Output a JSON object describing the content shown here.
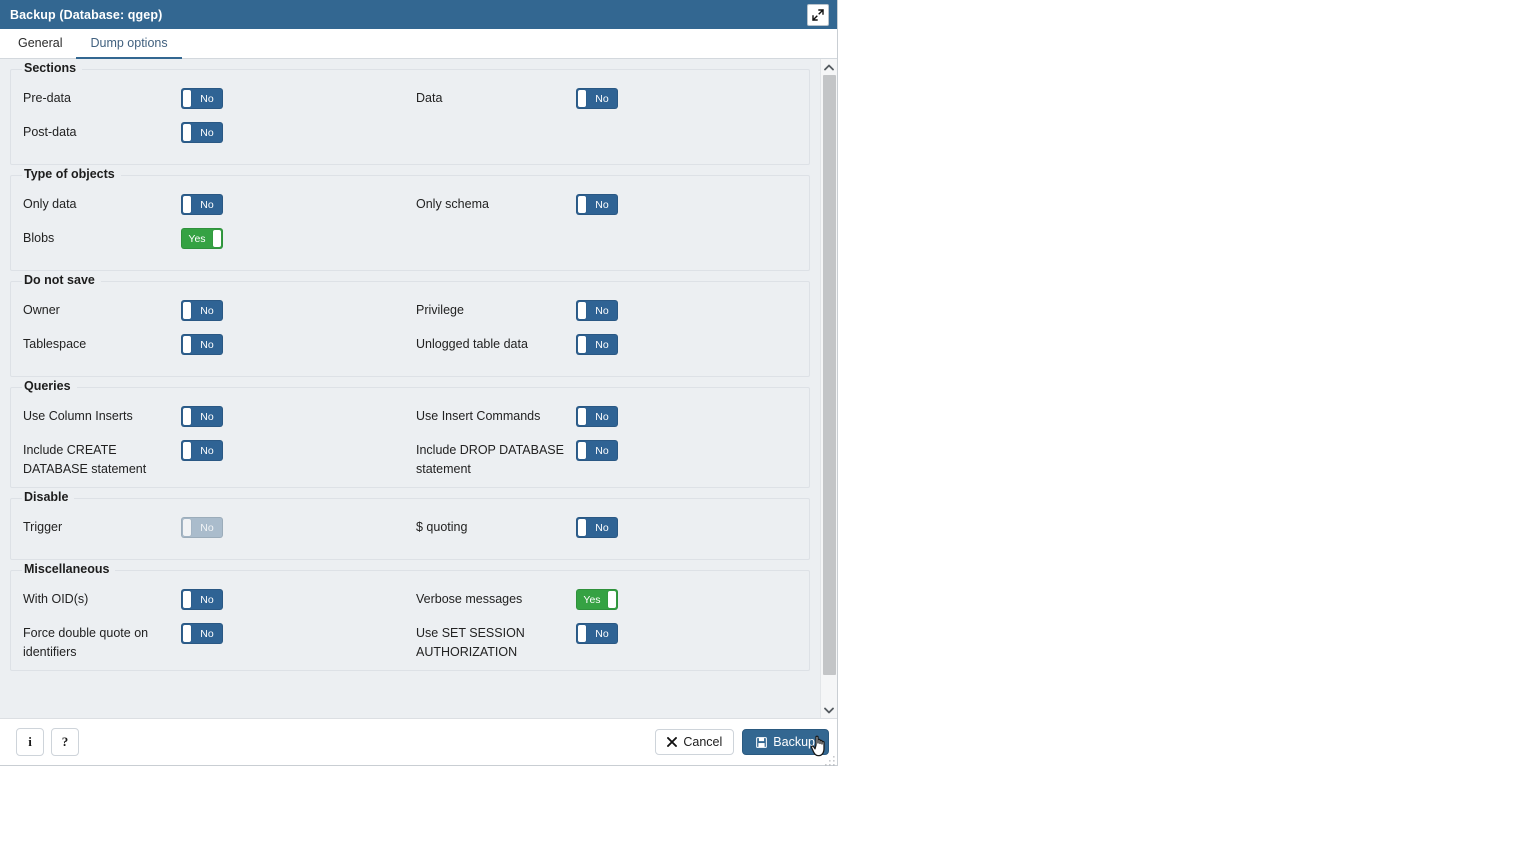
{
  "window": {
    "title": "Backup (Database: qgep)",
    "maximize_icon": "expand-diagonal-icon"
  },
  "tabs": [
    {
      "label": "General",
      "active": false
    },
    {
      "label": "Dump options",
      "active": true
    }
  ],
  "sections": [
    {
      "title": "Sections",
      "rows": [
        [
          {
            "label": "Pre-data",
            "value": "No",
            "state": "off",
            "disabled": false
          },
          {
            "label": "Data",
            "value": "No",
            "state": "off",
            "disabled": false
          }
        ],
        [
          {
            "label": "Post-data",
            "value": "No",
            "state": "off",
            "disabled": false
          },
          null
        ]
      ]
    },
    {
      "title": "Type of objects",
      "rows": [
        [
          {
            "label": "Only data",
            "value": "No",
            "state": "off",
            "disabled": false
          },
          {
            "label": "Only schema",
            "value": "No",
            "state": "off",
            "disabled": false
          }
        ],
        [
          {
            "label": "Blobs",
            "value": "Yes",
            "state": "on",
            "disabled": false
          },
          null
        ]
      ]
    },
    {
      "title": "Do not save",
      "rows": [
        [
          {
            "label": "Owner",
            "value": "No",
            "state": "off",
            "disabled": false
          },
          {
            "label": "Privilege",
            "value": "No",
            "state": "off",
            "disabled": false
          }
        ],
        [
          {
            "label": "Tablespace",
            "value": "No",
            "state": "off",
            "disabled": false
          },
          {
            "label": "Unlogged table data",
            "value": "No",
            "state": "off",
            "disabled": false
          }
        ]
      ]
    },
    {
      "title": "Queries",
      "rows": [
        [
          {
            "label": "Use Column Inserts",
            "value": "No",
            "state": "off",
            "disabled": false
          },
          {
            "label": "Use Insert Commands",
            "value": "No",
            "state": "off",
            "disabled": false
          }
        ],
        [
          {
            "label": "Include CREATE DATABASE statement",
            "value": "No",
            "state": "off",
            "disabled": false
          },
          {
            "label": "Include DROP DATABASE statement",
            "value": "No",
            "state": "off",
            "disabled": false
          }
        ]
      ]
    },
    {
      "title": "Disable",
      "rows": [
        [
          {
            "label": "Trigger",
            "value": "No",
            "state": "off",
            "disabled": true
          },
          {
            "label": "$ quoting",
            "value": "No",
            "state": "off",
            "disabled": false
          }
        ]
      ]
    },
    {
      "title": "Miscellaneous",
      "rows": [
        [
          {
            "label": "With OID(s)",
            "value": "No",
            "state": "off",
            "disabled": false
          },
          {
            "label": "Verbose messages",
            "value": "Yes",
            "state": "on",
            "disabled": false
          }
        ],
        [
          {
            "label": "Force double quote on identifiers",
            "value": "No",
            "state": "off",
            "disabled": false
          },
          {
            "label": "Use SET SESSION AUTHORIZATION",
            "value": "No",
            "state": "off",
            "disabled": false
          }
        ]
      ]
    }
  ],
  "scrollbar": {
    "up_icon": "chevron-up-icon",
    "down_icon": "chevron-down-icon"
  },
  "footer": {
    "info_label": "i",
    "help_label": "?",
    "cancel_label": "Cancel",
    "cancel_icon": "cross-icon",
    "backup_label": "Backup",
    "backup_icon": "floppy-save-icon"
  },
  "colors": {
    "titlebar": "#336791",
    "accent": "#336791",
    "toggle_off": "#2f6394",
    "toggle_on": "#35a243",
    "toggle_disabled": "#9fb4c6",
    "body_bg": "#eceff2"
  }
}
